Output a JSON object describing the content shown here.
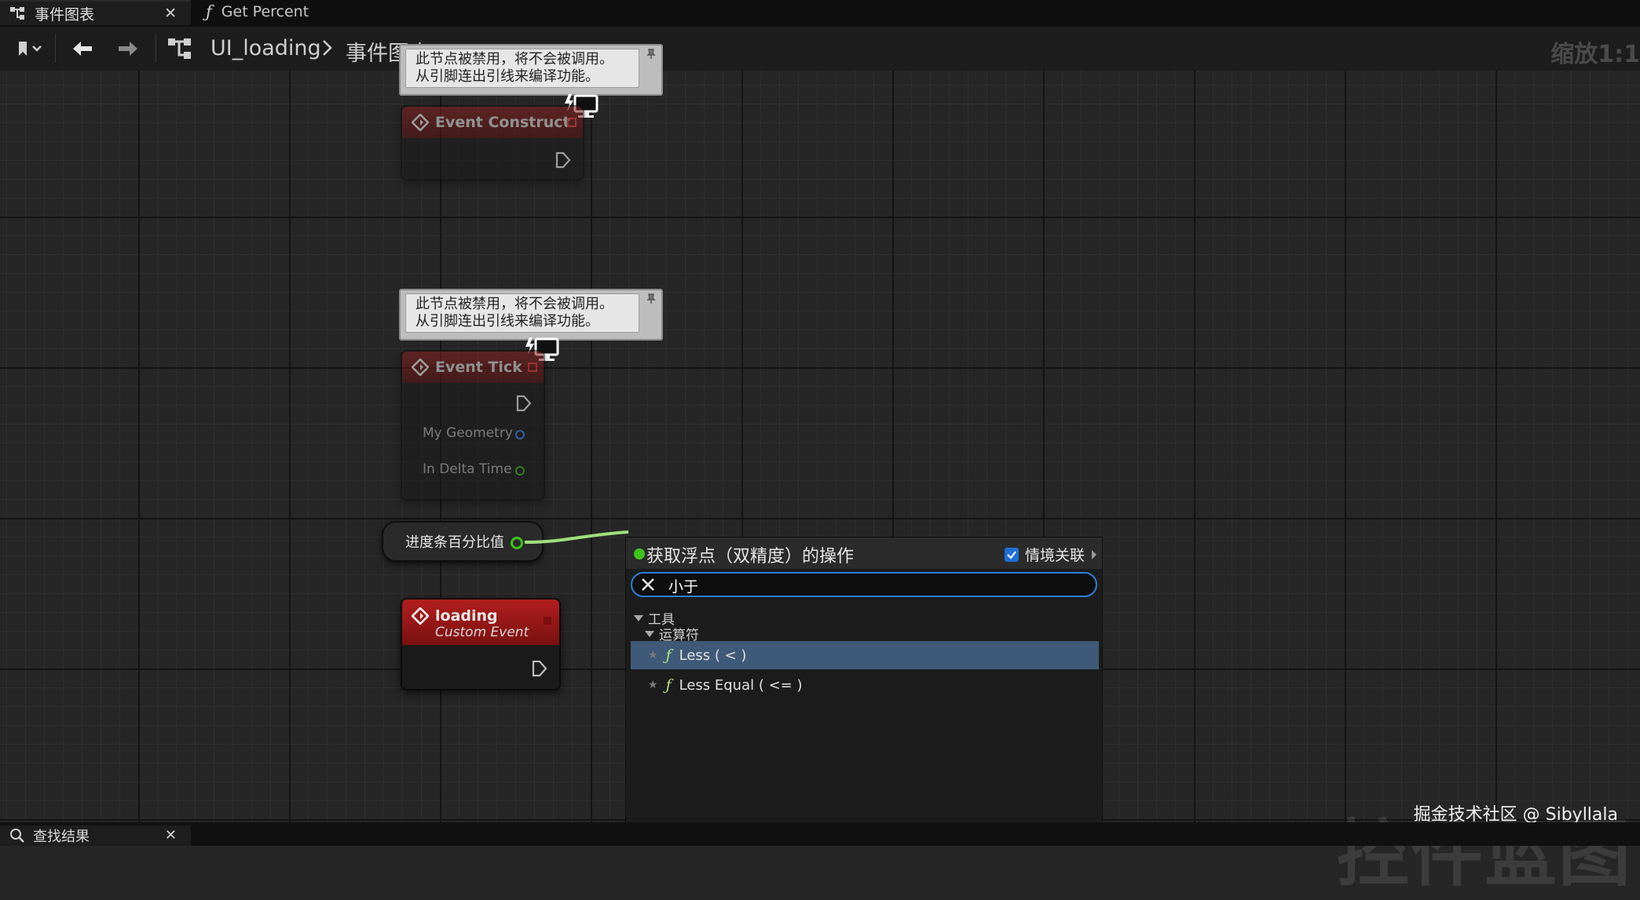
{
  "tabs": [
    {
      "label": "事件图表",
      "icon": "graph-icon",
      "active": true
    },
    {
      "label": "Get Percent",
      "icon": "function-icon",
      "active": false
    }
  ],
  "breadcrumb": {
    "root": "UI_loading",
    "current": "事件图表"
  },
  "zoom": "缩放1:1",
  "comments": [
    {
      "line1": "此节点被禁用，将不会被调用。",
      "line2": "从引脚连出引线来编译功能。"
    },
    {
      "line1": "此节点被禁用，将不会被调用。",
      "line2": "从引脚连出引线来编译功能。"
    }
  ],
  "nodes": {
    "event_construct": {
      "title": "Event Construct"
    },
    "event_tick": {
      "title": "Event Tick",
      "pins": [
        "My Geometry",
        "In Delta Time"
      ]
    },
    "progress_var": {
      "label": "进度条百分比值"
    },
    "loading": {
      "title": "loading",
      "subtitle": "Custom Event"
    }
  },
  "menu": {
    "title": "获取浮点（双精度）的操作",
    "context_label": "情境关联",
    "context_checked": true,
    "search_value": "小于",
    "categories": [
      {
        "label": "工具",
        "sub": [
          {
            "label": "运算符",
            "items": [
              "Less ( < )",
              "Less Equal ( <= )"
            ]
          }
        ]
      }
    ]
  },
  "watermark": "控件蓝图",
  "credit": "掘金技术社区 @ Sibyllala",
  "bottom_tab": {
    "label": "查找结果"
  },
  "colors": {
    "accent": "#2a7fd8",
    "event_red": "#8a2222",
    "float_green": "#3ec41b"
  }
}
